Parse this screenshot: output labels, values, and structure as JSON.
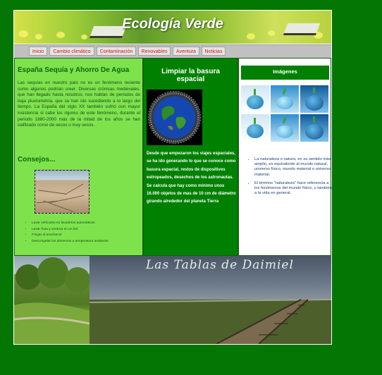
{
  "header": {
    "title": "Ecología Verde"
  },
  "nav": {
    "items": [
      {
        "label": "Inicio"
      },
      {
        "label": "Cambio climático"
      },
      {
        "label": "Contaminación"
      },
      {
        "label": "Renovables"
      },
      {
        "label": "Aventura"
      },
      {
        "label": "Noticias"
      }
    ]
  },
  "left": {
    "heading": "España Sequía y Ahorro De Agua",
    "paragraph": "Las sequías en nuestro país no es un fenómeno reciente como algunos podrían creer. Diversas crónicas medievales, que han llegado hasta nosotros, nos hablan de periodos de baja pluviometría, que se han ido sucediendo a lo largo del tiempo. La España del siglo XX también sufrió con mayor insistencia si cabe los rigores de este fenómeno, durante el periodo 1880-2000 más de la mitad de los años se han calificado como de secos o muy secos.",
    "tips_heading": "Consejos...",
    "tips": [
      "Lavar vehículos en lavaderos automáticos",
      "Lavar fruta y verdura en un bol",
      "Fregar al anochecer",
      "Descongelar los alimentos a temperatura ambiente"
    ]
  },
  "middle": {
    "heading": "Limpiar la basura espacial",
    "paragraph": "Desde que empezaron los viajes espaciales, se ha ido generando lo que se conoce como basura espacial, restos de dispositivos estropeados, desechos de los astronautas. Se calcula que hay como mínimo unos 16.000 objetos de mas de 10 cm de diámetro girando alrededor del planeta Tierra"
  },
  "right": {
    "heading": "Imágenes",
    "items": [
      "La naturaleza o natura, en su sentido más amplio, es equivalente al mundo natural, universo físico, mundo material o universo material.",
      "El término \"naturaleza\" hace referencia a los fenómenos del mundo físico, y también a la vida en general."
    ]
  },
  "footer": {
    "title": "Las Tablas de Daimiel"
  },
  "colors": {
    "background": "#047604",
    "left_column": "#7ee24d",
    "middle_column": "#008000",
    "nav_link": "#d41818"
  }
}
